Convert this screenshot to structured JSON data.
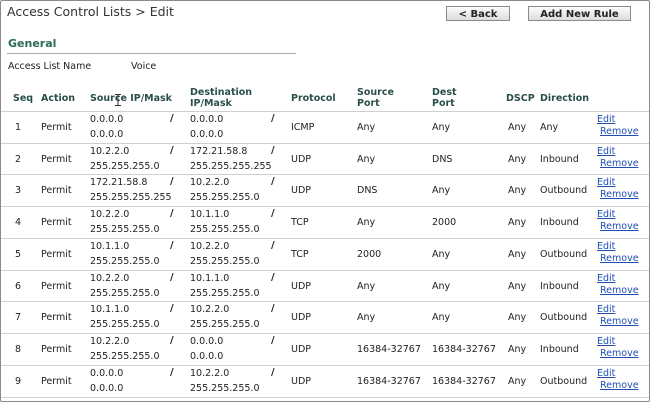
{
  "breadcrumb": "Access Control Lists > Edit",
  "buttons": {
    "back": "< Back",
    "add_new_rule": "Add New Rule"
  },
  "section": {
    "title": "General"
  },
  "acl": {
    "name_label": "Access List Name",
    "name_value": "Voice"
  },
  "columns": {
    "seq": "Seq",
    "action": "Action",
    "source": "Source IP/Mask",
    "dest_line1": "Destination",
    "dest_line2": "IP/Mask",
    "protocol": "Protocol",
    "sport_line1": "Source",
    "sport_line2": "Port",
    "dport_line1": "Dest",
    "dport_line2": "Port",
    "dscp": "DSCP",
    "direction": "Direction"
  },
  "slash": "/",
  "row_links": {
    "edit": "Edit",
    "remove": "Remove"
  },
  "rows": [
    {
      "seq": "1",
      "action": "Permit",
      "src_ip": "0.0.0.0",
      "src_mask": "0.0.0.0",
      "dst_ip": "0.0.0.0",
      "dst_mask": "0.0.0.0",
      "protocol": "ICMP",
      "src_port": "Any",
      "dst_port": "Any",
      "dscp": "Any",
      "direction": "Any"
    },
    {
      "seq": "2",
      "action": "Permit",
      "src_ip": "10.2.2.0",
      "src_mask": "255.255.255.0",
      "dst_ip": "172.21.58.8",
      "dst_mask": "255.255.255.255",
      "protocol": "UDP",
      "src_port": "Any",
      "dst_port": "DNS",
      "dscp": "Any",
      "direction": "Inbound"
    },
    {
      "seq": "3",
      "action": "Permit",
      "src_ip": "172.21.58.8",
      "src_mask": "255.255.255.255",
      "dst_ip": "10.2.2.0",
      "dst_mask": "255.255.255.0",
      "protocol": "UDP",
      "src_port": "DNS",
      "dst_port": "Any",
      "dscp": "Any",
      "direction": "Outbound"
    },
    {
      "seq": "4",
      "action": "Permit",
      "src_ip": "10.2.2.0",
      "src_mask": "255.255.255.0",
      "dst_ip": "10.1.1.0",
      "dst_mask": "255.255.255.0",
      "protocol": "TCP",
      "src_port": "Any",
      "dst_port": "2000",
      "dscp": "Any",
      "direction": "Inbound"
    },
    {
      "seq": "5",
      "action": "Permit",
      "src_ip": "10.1.1.0",
      "src_mask": "255.255.255.0",
      "dst_ip": "10.2.2.0",
      "dst_mask": "255.255.255.0",
      "protocol": "TCP",
      "src_port": "2000",
      "dst_port": "Any",
      "dscp": "Any",
      "direction": "Outbound"
    },
    {
      "seq": "6",
      "action": "Permit",
      "src_ip": "10.2.2.0",
      "src_mask": "255.255.255.0",
      "dst_ip": "10.1.1.0",
      "dst_mask": "255.255.255.0",
      "protocol": "UDP",
      "src_port": "Any",
      "dst_port": "Any",
      "dscp": "Any",
      "direction": "Inbound"
    },
    {
      "seq": "7",
      "action": "Permit",
      "src_ip": "10.1.1.0",
      "src_mask": "255.255.255.0",
      "dst_ip": "10.2.2.0",
      "dst_mask": "255.255.255.0",
      "protocol": "UDP",
      "src_port": "Any",
      "dst_port": "Any",
      "dscp": "Any",
      "direction": "Outbound"
    },
    {
      "seq": "8",
      "action": "Permit",
      "src_ip": "10.2.2.0",
      "src_mask": "255.255.255.0",
      "dst_ip": "0.0.0.0",
      "dst_mask": "0.0.0.0",
      "protocol": "UDP",
      "src_port": "16384-32767",
      "dst_port": "16384-32767",
      "dscp": "Any",
      "direction": "Inbound"
    },
    {
      "seq": "9",
      "action": "Permit",
      "src_ip": "0.0.0.0",
      "src_mask": "0.0.0.0",
      "dst_ip": "10.2.2.0",
      "dst_mask": "255.255.255.0",
      "protocol": "UDP",
      "src_port": "16384-32767",
      "dst_port": "16384-32767",
      "dscp": "Any",
      "direction": "Outbound"
    }
  ]
}
